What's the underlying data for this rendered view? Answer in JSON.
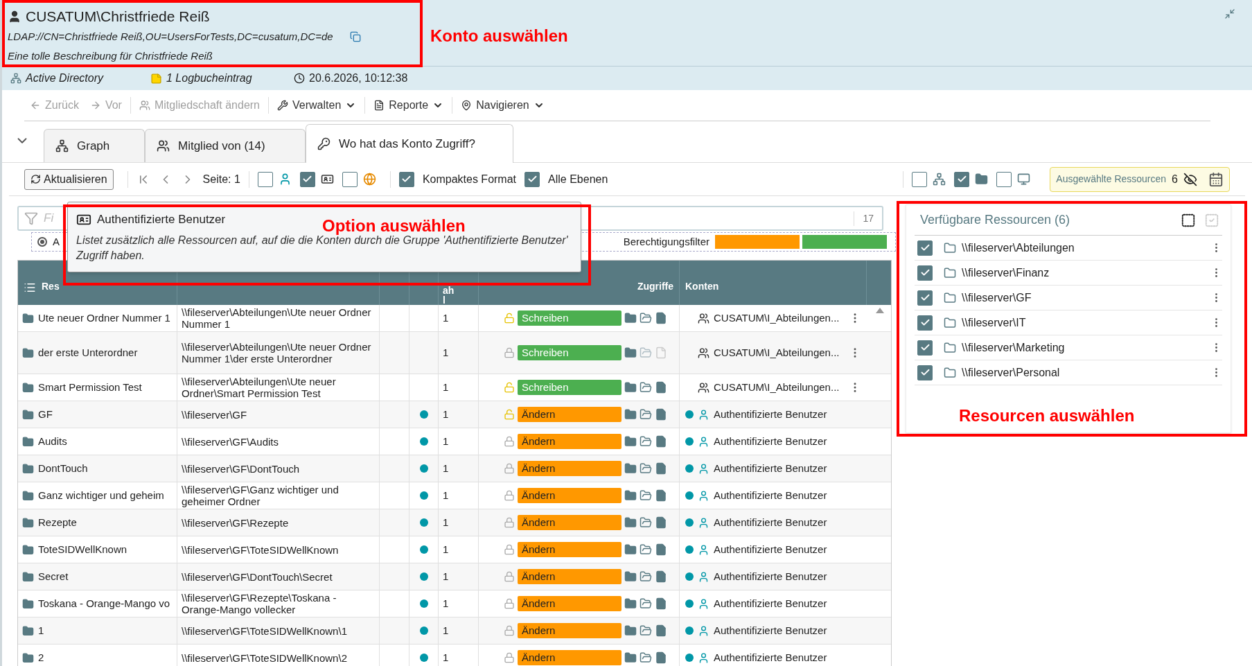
{
  "header": {
    "title": "CUSATUM\\Christfriede Reiß",
    "ldap": "LDAP://CN=Christfriede Reiß,OU=UsersForTests,DC=cusatum,DC=de",
    "description": "Eine tolle Beschreibung für Christfriede Reiß",
    "source": "Active Directory",
    "log": "1 Logbucheintrag",
    "timestamp": "20.6.2026, 10:12:38"
  },
  "toolbar": [
    {
      "label": "Zurück",
      "disabled": true,
      "dropdown": false
    },
    {
      "label": "Vor",
      "disabled": true,
      "dropdown": false
    },
    {
      "label": "Mitgliedschaft ändern",
      "disabled": true,
      "dropdown": false
    },
    {
      "label": "Verwalten",
      "disabled": false,
      "dropdown": true
    },
    {
      "label": "Reporte",
      "disabled": false,
      "dropdown": true
    },
    {
      "label": "Navigieren",
      "disabled": false,
      "dropdown": true
    }
  ],
  "tabs": [
    {
      "label": "Graph",
      "selected": false
    },
    {
      "label": "Mitglied von (14)",
      "selected": false
    },
    {
      "label": "Wo hat das Konto Zugriff?",
      "selected": true
    }
  ],
  "action_bar": {
    "refresh": "Aktualisieren",
    "page": "Seite: 1",
    "view_options": [
      {
        "checked": false
      },
      {
        "checked": true
      },
      {
        "checked": false
      }
    ],
    "compact": {
      "label": "Kompaktes Format",
      "checked": true
    },
    "all_levels": {
      "label": "Alle Ebenen",
      "checked": true
    },
    "right_options": [
      {
        "checked": false
      },
      {
        "checked": true
      },
      {
        "checked": false
      }
    ],
    "selected_resources": {
      "label": "Ausgewählte Ressourcen",
      "count": "6"
    }
  },
  "filter": {
    "placeholder": "Fi",
    "count": "17",
    "radio": {
      "label": "A",
      "selected": true
    },
    "permission_filter": {
      "label": "Berechtigungsfilter",
      "bars": [
        {
          "color": "#ff9800"
        },
        {
          "color": "#4caf50"
        }
      ]
    }
  },
  "tooltip": {
    "title": "Authentifizierte Benutzer",
    "text": "Listet zusätzlich alle Ressourcen auf, auf die die Konten durch die Gruppe 'Authentifizierte Benutzer' Zugriff haben."
  },
  "table": {
    "columns": {
      "column_1": "Res",
      "column_5": "ah l",
      "access": "Zugriffe",
      "accounts": "Konten"
    },
    "rows": [
      {
        "name": "Ute neuer Ordner Nummer 1",
        "path": "\\\\fileserver\\Abteilungen\\Ute neuer Ordner Nummer 1",
        "dot": false,
        "count": "1",
        "unlocked": true,
        "access": {
          "label": "Schreiben",
          "color": "#4caf50"
        },
        "faded": false,
        "account": {
          "kind": "group",
          "name": "CUSATUM\\I_Abteilungen...",
          "dot": false
        }
      },
      {
        "name": "der erste Unterordner",
        "path": "\\\\fileserver\\Abteilungen\\Ute neuer Ordner Nummer 1\\der erste Unterordner",
        "dot": false,
        "count": "1",
        "unlocked": false,
        "access": {
          "label": "Schreiben",
          "color": "#4caf50"
        },
        "faded": true,
        "account": {
          "kind": "group",
          "name": "CUSATUM\\I_Abteilungen...",
          "dot": false
        }
      },
      {
        "name": "Smart Permission Test",
        "path": "\\\\fileserver\\Abteilungen\\Ute neuer Ordner\\Smart Permission Test",
        "dot": false,
        "count": "1",
        "unlocked": true,
        "access": {
          "label": "Schreiben",
          "color": "#4caf50"
        },
        "faded": false,
        "account": {
          "kind": "group",
          "name": "CUSATUM\\I_Abteilungen...",
          "dot": false
        }
      },
      {
        "name": "GF",
        "path": "\\\\fileserver\\GF",
        "dot": true,
        "count": "1",
        "unlocked": true,
        "access": {
          "label": "Ändern",
          "color": "#ff9800"
        },
        "faded": false,
        "account": {
          "kind": "user",
          "name": "Authentifizierte Benutzer",
          "dot": true
        }
      },
      {
        "name": "Audits",
        "path": "\\\\fileserver\\GF\\Audits",
        "dot": true,
        "count": "1",
        "unlocked": false,
        "access": {
          "label": "Ändern",
          "color": "#ff9800"
        },
        "faded": false,
        "account": {
          "kind": "user",
          "name": "Authentifizierte Benutzer",
          "dot": true
        }
      },
      {
        "name": "DontTouch",
        "path": "\\\\fileserver\\GF\\DontTouch",
        "dot": true,
        "count": "1",
        "unlocked": false,
        "access": {
          "label": "Ändern",
          "color": "#ff9800"
        },
        "faded": false,
        "account": {
          "kind": "user",
          "name": "Authentifizierte Benutzer",
          "dot": true
        }
      },
      {
        "name": "Ganz wichtiger und geheim",
        "path": "\\\\fileserver\\GF\\Ganz wichtiger und geheimer Ordner",
        "dot": true,
        "count": "1",
        "unlocked": false,
        "access": {
          "label": "Ändern",
          "color": "#ff9800"
        },
        "faded": false,
        "account": {
          "kind": "user",
          "name": "Authentifizierte Benutzer",
          "dot": true
        }
      },
      {
        "name": "Rezepte",
        "path": "\\\\fileserver\\GF\\Rezepte",
        "dot": true,
        "count": "1",
        "unlocked": false,
        "access": {
          "label": "Ändern",
          "color": "#ff9800"
        },
        "faded": false,
        "account": {
          "kind": "user",
          "name": "Authentifizierte Benutzer",
          "dot": true
        }
      },
      {
        "name": "ToteSIDWellKnown",
        "path": "\\\\fileserver\\GF\\ToteSIDWellKnown",
        "dot": true,
        "count": "1",
        "unlocked": false,
        "access": {
          "label": "Ändern",
          "color": "#ff9800"
        },
        "faded": false,
        "account": {
          "kind": "user",
          "name": "Authentifizierte Benutzer",
          "dot": true
        }
      },
      {
        "name": "Secret",
        "path": "\\\\fileserver\\GF\\DontTouch\\Secret",
        "dot": true,
        "count": "1",
        "unlocked": false,
        "access": {
          "label": "Ändern",
          "color": "#ff9800"
        },
        "faded": false,
        "account": {
          "kind": "user",
          "name": "Authentifizierte Benutzer",
          "dot": true
        }
      },
      {
        "name": "Toskana - Orange-Mango vo",
        "path": "\\\\fileserver\\GF\\Rezepte\\Toskana - Orange-Mango vollecker",
        "dot": true,
        "count": "1",
        "unlocked": false,
        "access": {
          "label": "Ändern",
          "color": "#ff9800"
        },
        "faded": false,
        "account": {
          "kind": "user",
          "name": "Authentifizierte Benutzer",
          "dot": true
        }
      },
      {
        "name": "1",
        "path": "\\\\fileserver\\GF\\ToteSIDWellKnown\\1",
        "dot": true,
        "count": "1",
        "unlocked": false,
        "access": {
          "label": "Ändern",
          "color": "#ff9800"
        },
        "faded": false,
        "account": {
          "kind": "user",
          "name": "Authentifizierte Benutzer",
          "dot": true
        }
      },
      {
        "name": "2",
        "path": "\\\\fileserver\\GF\\ToteSIDWellKnown\\2",
        "dot": true,
        "count": "1",
        "unlocked": false,
        "access": {
          "label": "Ändern",
          "color": "#ff9800"
        },
        "faded": false,
        "account": {
          "kind": "user",
          "name": "Authentifizierte Benutzer",
          "dot": true
        }
      }
    ]
  },
  "resources_panel": {
    "title": "Verfügbare Ressourcen (6)",
    "items": [
      {
        "label": "\\\\fileserver\\Abteilungen",
        "checked": true
      },
      {
        "label": "\\\\fileserver\\Finanz",
        "checked": true
      },
      {
        "label": "\\\\fileserver\\GF",
        "checked": true
      },
      {
        "label": "\\\\fileserver\\IT",
        "checked": true
      },
      {
        "label": "\\\\fileserver\\Marketing",
        "checked": true
      },
      {
        "label": "\\\\fileserver\\Personal",
        "checked": true
      }
    ]
  },
  "annotations": [
    {
      "label": "Konto auswählen"
    },
    {
      "label": "Option auswählen"
    },
    {
      "label": "Resourcen auswählen"
    }
  ]
}
